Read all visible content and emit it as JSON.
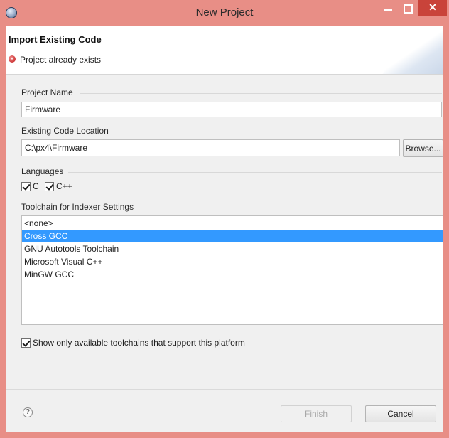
{
  "window": {
    "title": "New Project",
    "controls": {
      "minimize": "",
      "maximize": "",
      "close": "✕"
    }
  },
  "header": {
    "title": "Import Existing Code",
    "message": "Project already exists",
    "message_type": "error"
  },
  "form": {
    "project_name": {
      "label": "Project Name",
      "value": "Firmware"
    },
    "code_location": {
      "label": "Existing Code Location",
      "value": "C:\\px4\\Firmware",
      "browse_label": "Browse..."
    },
    "languages": {
      "label": "Languages",
      "options": [
        {
          "label": "C",
          "checked": true
        },
        {
          "label": "C++",
          "checked": true
        }
      ]
    },
    "toolchain": {
      "label": "Toolchain for Indexer Settings",
      "items": [
        "<none>",
        "Cross GCC",
        "GNU Autotools Toolchain",
        "Microsoft Visual C++",
        "MinGW GCC"
      ],
      "selected": "Cross GCC"
    },
    "show_available": {
      "label": "Show only available toolchains that support this platform",
      "checked": true
    }
  },
  "footer": {
    "help_icon": "question-icon",
    "finish_label": "Finish",
    "finish_enabled": false,
    "cancel_label": "Cancel"
  },
  "colors": {
    "titlebar": "#e88e86",
    "close_button": "#c9433a",
    "selection": "#3399ff",
    "dialog_bg": "#f0f0f0"
  }
}
